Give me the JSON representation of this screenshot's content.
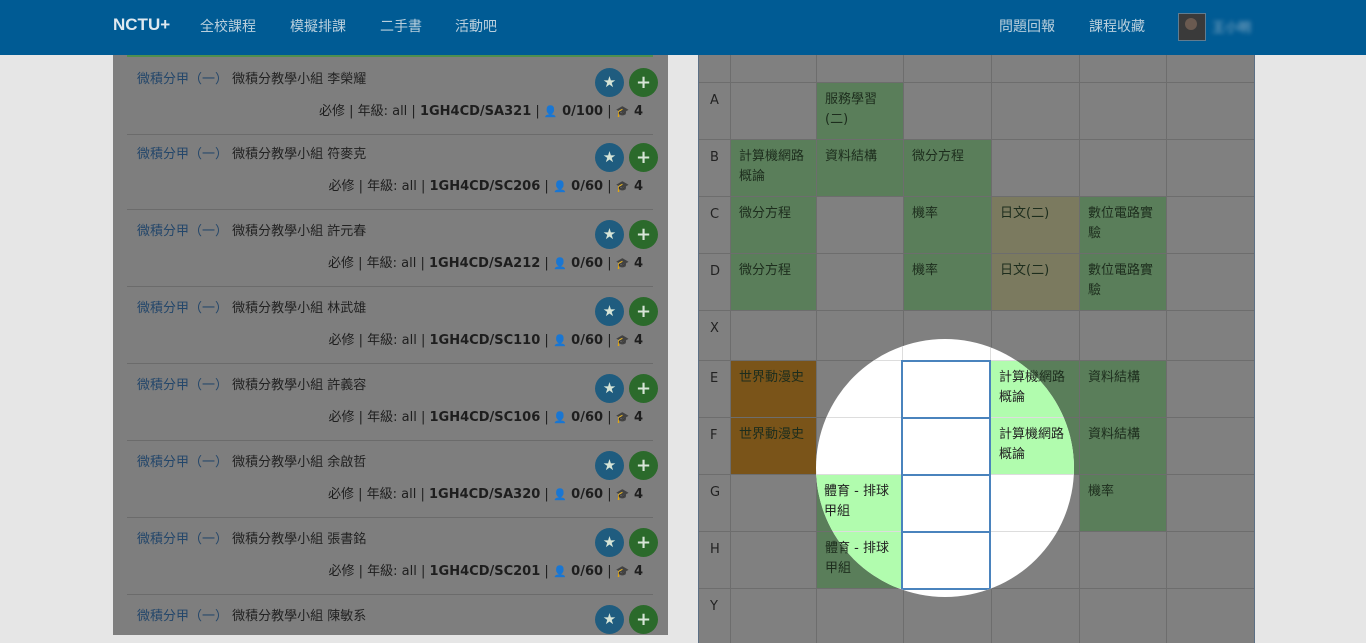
{
  "nav": {
    "brand": "NCTU+",
    "links": [
      "全校課程",
      "模擬排課",
      "二手書",
      "活動吧"
    ],
    "right_links": [
      "問題回報",
      "課程收藏"
    ],
    "user_name": "王小明"
  },
  "courses": [
    {
      "title": "微積分甲（一）",
      "teacher": "微積分教學小組 李榮耀",
      "req": "必修",
      "grade": "年級: all",
      "code": "1GH4CD/SA321",
      "enroll": "0/100",
      "credits": "4"
    },
    {
      "title": "微積分甲（一）",
      "teacher": "微積分教學小組 符麥克",
      "req": "必修",
      "grade": "年級: all",
      "code": "1GH4CD/SC206",
      "enroll": "0/60",
      "credits": "4"
    },
    {
      "title": "微積分甲（一）",
      "teacher": "微積分教學小組 許元春",
      "req": "必修",
      "grade": "年級: all",
      "code": "1GH4CD/SA212",
      "enroll": "0/60",
      "credits": "4"
    },
    {
      "title": "微積分甲（一）",
      "teacher": "微積分教學小組 林武雄",
      "req": "必修",
      "grade": "年級: all",
      "code": "1GH4CD/SC110",
      "enroll": "0/60",
      "credits": "4"
    },
    {
      "title": "微積分甲（一）",
      "teacher": "微積分教學小組 許義容",
      "req": "必修",
      "grade": "年級: all",
      "code": "1GH4CD/SC106",
      "enroll": "0/60",
      "credits": "4"
    },
    {
      "title": "微積分甲（一）",
      "teacher": "微積分教學小組 余啟哲",
      "req": "必修",
      "grade": "年級: all",
      "code": "1GH4CD/SA320",
      "enroll": "0/60",
      "credits": "4"
    },
    {
      "title": "微積分甲（一）",
      "teacher": "微積分教學小組 張書銘",
      "req": "必修",
      "grade": "年級: all",
      "code": "1GH4CD/SC201",
      "enroll": "0/60",
      "credits": "4"
    },
    {
      "title": "微積分甲（一）",
      "teacher": "微積分教學小組 陳敏系",
      "req": "",
      "grade": "",
      "code": "",
      "enroll": "",
      "credits": ""
    }
  ],
  "labels": {
    "star": "★",
    "add": "+",
    "sep": "|",
    "user_icon": "👤",
    "cap_icon": "🎓"
  },
  "timetable": {
    "rows": [
      "A",
      "B",
      "C",
      "D",
      "X",
      "E",
      "F",
      "G",
      "H",
      "Y"
    ],
    "cells": {
      "A2": "服務學習(二)",
      "B1": "計算機網路概論",
      "B2": "資料結構",
      "B3": "微分方程",
      "C1": "微分方程",
      "C3": "機率",
      "C4": "日文(二)",
      "C5": "數位電路實驗",
      "D1": "微分方程",
      "D3": "機率",
      "D4": "日文(二)",
      "D5": "數位電路實驗",
      "E1": "世界動漫史",
      "E4": "計算機網路概論",
      "E5": "資料結構",
      "F1": "世界動漫史",
      "F4": "計算機網路概論",
      "F5": "資料結構",
      "G2": "體育 - 排球甲組",
      "G5": "機率",
      "H2": "體育 - 排球甲組"
    }
  },
  "colors": {
    "nav": "#005b94",
    "course_green": "#b1fcae",
    "hover_border": "#4a83bd"
  }
}
